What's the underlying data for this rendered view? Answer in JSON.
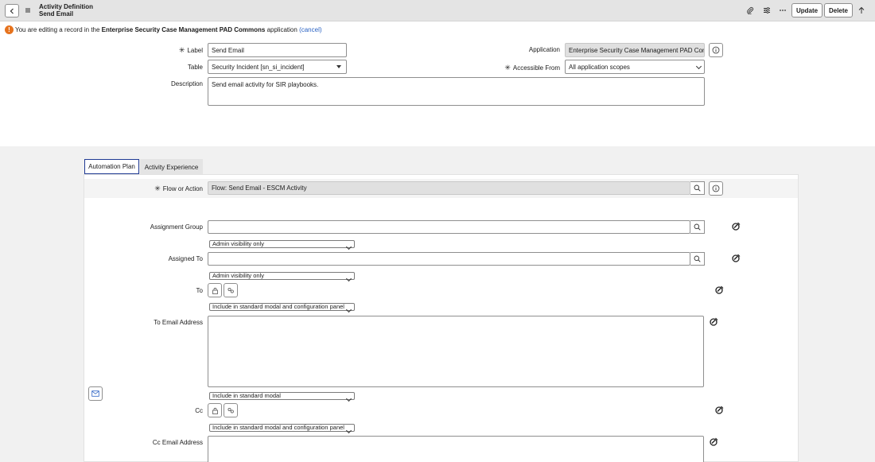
{
  "header": {
    "title": "Activity Definition",
    "subtitle": "Send Email",
    "update_label": "Update",
    "delete_label": "Delete"
  },
  "notice": {
    "prefix": "You are editing a record in the ",
    "app_name": "Enterprise Security Case Management PAD Commons",
    "suffix": " application ",
    "cancel_label": "(cancel)"
  },
  "form": {
    "label_label": "Label",
    "label_value": "Send Email",
    "table_label": "Table",
    "table_value": "Security Incident [sn_si_incident]",
    "description_label": "Description",
    "description_value": "Send email activity for SIR playbooks.",
    "application_label": "Application",
    "application_value": "Enterprise Security Case Management PAD Commons",
    "accessible_from_label": "Accessible From",
    "accessible_from_value": "All application scopes"
  },
  "tabs": [
    {
      "label": "Automation Plan",
      "active": true
    },
    {
      "label": "Activity Experience",
      "active": false
    }
  ],
  "automation": {
    "flow_label": "Flow or Action",
    "flow_value": "Flow: Send Email - ESCM Activity",
    "assignment_group_label": "Assignment Group",
    "assignment_group_visibility": "Admin visibility only",
    "assigned_to_label": "Assigned To",
    "assigned_to_visibility": "Admin visibility only",
    "to_label": "To",
    "to_visibility": "Include in standard modal and configuration panel",
    "to_email_label": "To Email Address",
    "to_email_visibility": "Include in standard modal",
    "cc_label": "Cc",
    "cc_visibility": "Include in standard modal and configuration panel",
    "cc_email_label": "Cc Email Address"
  },
  "colors": {
    "accent": "#1f3a93",
    "warning": "#e6731e",
    "link": "#2a62c3"
  }
}
